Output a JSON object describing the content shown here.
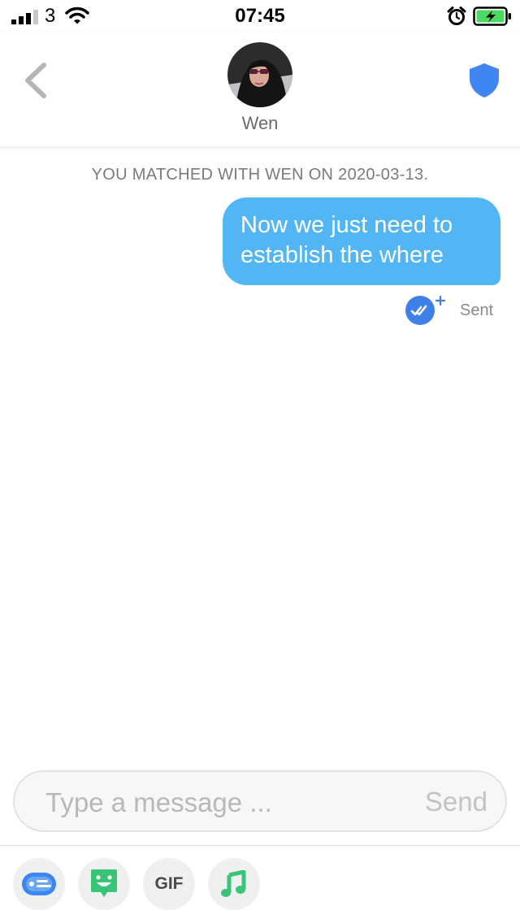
{
  "status_bar": {
    "carrier": "3",
    "time": "07:45",
    "icons": [
      "signal-icon",
      "wifi-icon",
      "alarm-icon",
      "battery-charging-icon"
    ]
  },
  "header": {
    "contact_name": "Wen",
    "icons": [
      "back-chevron-icon",
      "profile-avatar",
      "safety-shield-icon"
    ],
    "accent_color": "#3f86f2"
  },
  "conversation": {
    "match_notice": "YOU MATCHED WITH WEN ON 2020-03-13.",
    "messages": [
      {
        "text": "Now we just need to establish the where",
        "direction": "outgoing",
        "status": "Sent",
        "bubble_color": "#52b6f4"
      }
    ]
  },
  "composer": {
    "placeholder": "Type a message ...",
    "value": "",
    "send_label": "Send"
  },
  "toolbar": {
    "gif_label": "GIF",
    "icons": [
      "contact-card-icon",
      "sticker-icon",
      "gif-icon",
      "music-icon"
    ]
  }
}
